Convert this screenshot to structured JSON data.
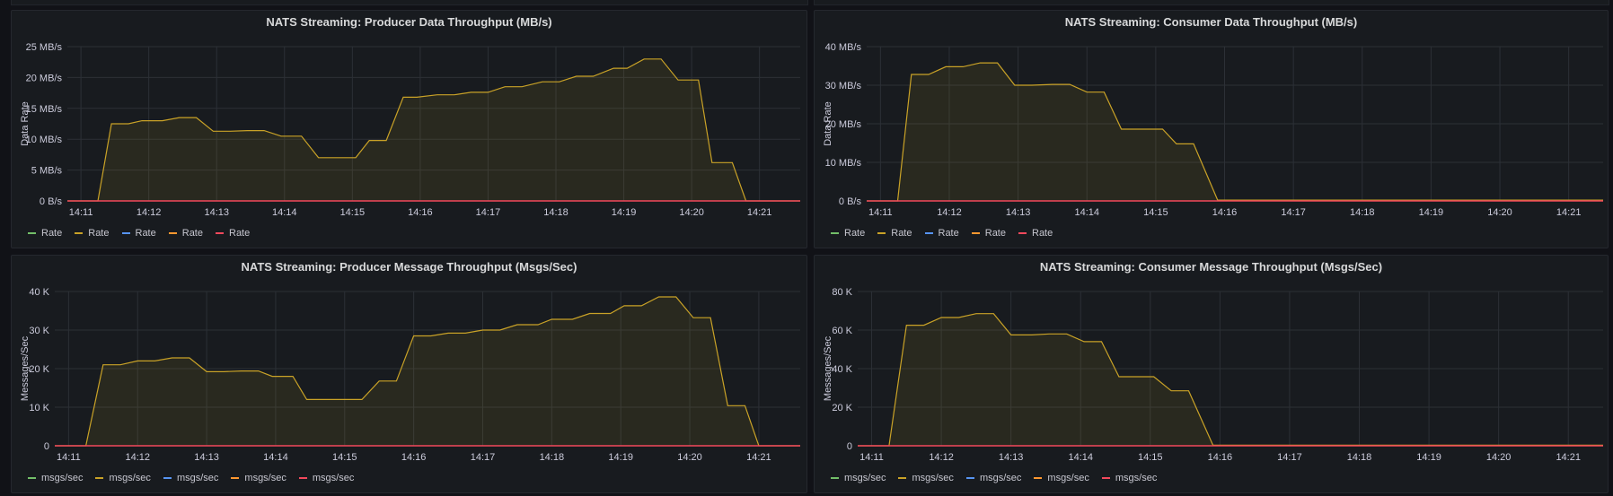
{
  "colors": {
    "background": "#111217",
    "panel": "#181b1f",
    "grid": "#2c3036",
    "text": "#ccccdc",
    "series_green": "#73bf69",
    "series_yellow": "#c9a227",
    "series_blue": "#5794f2",
    "series_orange": "#ff9830",
    "series_red": "#f2495c"
  },
  "panels": [
    {
      "id": "producer-data",
      "title": "NATS Streaming: Producer Data Throughput (MB/s)",
      "legend": [
        "Rate",
        "Rate",
        "Rate",
        "Rate",
        "Rate"
      ]
    },
    {
      "id": "consumer-data",
      "title": "NATS Streaming: Consumer Data Throughput (MB/s)",
      "legend": [
        "Rate",
        "Rate",
        "Rate",
        "Rate",
        "Rate"
      ]
    },
    {
      "id": "producer-msg",
      "title": "NATS Streaming: Producer Message Throughput (Msgs/Sec)",
      "legend": [
        "msgs/sec",
        "msgs/sec",
        "msgs/sec",
        "msgs/sec",
        "msgs/sec"
      ]
    },
    {
      "id": "consumer-msg",
      "title": "NATS Streaming: Consumer Message Throughput (Msgs/Sec)",
      "legend": [
        "msgs/sec",
        "msgs/sec",
        "msgs/sec",
        "msgs/sec",
        "msgs/sec"
      ]
    }
  ],
  "chart_data": [
    {
      "type": "area",
      "title": "NATS Streaming: Producer Data Throughput (MB/s)",
      "ylabel": "Data Rate",
      "yticks": [
        "0 B/s",
        "5 MB/s",
        "10 MB/s",
        "15 MB/s",
        "20 MB/s",
        "25 MB/s"
      ],
      "ylim": [
        0,
        25
      ],
      "xticks": [
        "14:11",
        "14:12",
        "14:13",
        "14:14",
        "14:15",
        "14:16",
        "14:17",
        "14:18",
        "14:19",
        "14:20",
        "14:21"
      ],
      "xlim": [
        10.8,
        21.6
      ],
      "x": [
        10.8,
        11.25,
        11.45,
        11.7,
        11.9,
        12.2,
        12.45,
        12.7,
        12.95,
        13.2,
        13.45,
        13.7,
        13.95,
        14.25,
        14.5,
        14.8,
        15.05,
        15.25,
        15.5,
        15.75,
        15.95,
        16.25,
        16.5,
        16.75,
        17.0,
        17.25,
        17.5,
        17.8,
        18.05,
        18.3,
        18.55,
        18.85,
        19.05,
        19.3,
        19.55,
        19.8,
        20.1,
        20.3,
        20.6,
        20.8,
        21.0,
        21.6
      ],
      "series": [
        {
          "values": [
            0,
            0,
            12.5,
            12.5,
            13.0,
            13.0,
            13.5,
            13.5,
            11.3,
            11.3,
            11.4,
            11.4,
            10.5,
            10.5,
            7.0,
            7.0,
            7.0,
            9.8,
            9.8,
            16.8,
            16.8,
            17.2,
            17.2,
            17.6,
            17.6,
            18.5,
            18.5,
            19.3,
            19.3,
            20.2,
            20.2,
            21.5,
            21.5,
            23.0,
            23.0,
            19.6,
            19.6,
            6.2,
            6.2,
            0,
            0,
            0
          ]
        },
        {
          "values": [
            0,
            0,
            0,
            0,
            0,
            0,
            0,
            0,
            0,
            0,
            0,
            0,
            0,
            0,
            0,
            0,
            0,
            0,
            0,
            0,
            0,
            0,
            0,
            0,
            0,
            0,
            0,
            0,
            0,
            0,
            0,
            0,
            0,
            0,
            0,
            0,
            0,
            0,
            0,
            0,
            0,
            0
          ]
        }
      ]
    },
    {
      "type": "area",
      "title": "NATS Streaming: Consumer Data Throughput (MB/s)",
      "ylabel": "Data Rate",
      "yticks": [
        "0 B/s",
        "10 MB/s",
        "20 MB/s",
        "30 MB/s",
        "40 MB/s"
      ],
      "ylim": [
        0,
        40
      ],
      "xticks": [
        "14:11",
        "14:12",
        "14:13",
        "14:14",
        "14:15",
        "14:16",
        "14:17",
        "14:18",
        "14:19",
        "14:20",
        "14:21"
      ],
      "xlim": [
        10.8,
        21.5
      ],
      "x": [
        10.8,
        11.25,
        11.45,
        11.7,
        11.95,
        12.2,
        12.45,
        12.7,
        12.95,
        13.2,
        13.5,
        13.75,
        14.0,
        14.25,
        14.5,
        14.8,
        15.1,
        15.3,
        15.55,
        15.9,
        21.5
      ],
      "series": [
        {
          "values": [
            0,
            0,
            32.8,
            32.8,
            34.8,
            34.8,
            35.8,
            35.8,
            30.0,
            30.0,
            30.2,
            30.2,
            28.2,
            28.2,
            18.6,
            18.6,
            18.6,
            14.8,
            14.8,
            0.2,
            0.2
          ]
        },
        {
          "values": [
            0,
            0,
            0,
            0,
            0,
            0,
            0,
            0,
            0,
            0,
            0,
            0,
            0,
            0,
            0,
            0,
            0,
            0,
            0,
            0,
            0
          ]
        }
      ]
    },
    {
      "type": "area",
      "title": "NATS Streaming: Producer Message Throughput (Msgs/Sec)",
      "ylabel": "Messages/Sec",
      "yticks": [
        "0",
        "10 K",
        "20 K",
        "30 K",
        "40 K"
      ],
      "ylim": [
        0,
        40
      ],
      "xticks": [
        "14:11",
        "14:12",
        "14:13",
        "14:14",
        "14:15",
        "14:16",
        "14:17",
        "14:18",
        "14:19",
        "14:20",
        "14:21"
      ],
      "xlim": [
        10.8,
        21.6
      ],
      "x": [
        10.8,
        11.25,
        11.5,
        11.75,
        12.0,
        12.25,
        12.5,
        12.75,
        13.0,
        13.25,
        13.5,
        13.75,
        13.95,
        14.25,
        14.45,
        14.75,
        14.95,
        15.25,
        15.5,
        15.75,
        16.0,
        16.25,
        16.5,
        16.75,
        17.0,
        17.25,
        17.5,
        17.8,
        18.0,
        18.3,
        18.55,
        18.85,
        19.05,
        19.3,
        19.55,
        19.8,
        20.05,
        20.3,
        20.55,
        20.8,
        21.0,
        21.6
      ],
      "series": [
        {
          "values": [
            0,
            0,
            21.0,
            21.0,
            22.0,
            22.0,
            22.8,
            22.8,
            19.2,
            19.2,
            19.4,
            19.4,
            18.0,
            18.0,
            12.0,
            12.0,
            12.0,
            12.0,
            16.8,
            16.8,
            28.5,
            28.5,
            29.2,
            29.2,
            30.0,
            30.0,
            31.4,
            31.4,
            32.8,
            32.8,
            34.3,
            34.3,
            36.3,
            36.3,
            38.6,
            38.6,
            33.2,
            33.2,
            10.4,
            10.4,
            0,
            0
          ]
        },
        {
          "values": [
            0,
            0,
            0,
            0,
            0,
            0,
            0,
            0,
            0,
            0,
            0,
            0,
            0,
            0,
            0,
            0,
            0,
            0,
            0,
            0,
            0,
            0,
            0,
            0,
            0,
            0,
            0,
            0,
            0,
            0,
            0,
            0,
            0,
            0,
            0,
            0,
            0,
            0,
            0,
            0,
            0,
            0
          ]
        }
      ]
    },
    {
      "type": "area",
      "title": "NATS Streaming: Consumer Message Throughput (Msgs/Sec)",
      "ylabel": "Messages/Sec",
      "yticks": [
        "0",
        "20 K",
        "40 K",
        "60 K",
        "80 K"
      ],
      "ylim": [
        0,
        80
      ],
      "xticks": [
        "14:11",
        "14:12",
        "14:13",
        "14:14",
        "14:15",
        "14:16",
        "14:17",
        "14:18",
        "14:19",
        "14:20",
        "14:21"
      ],
      "xlim": [
        10.8,
        21.5
      ],
      "x": [
        10.8,
        11.25,
        11.5,
        11.75,
        12.0,
        12.25,
        12.5,
        12.75,
        13.0,
        13.3,
        13.55,
        13.8,
        14.05,
        14.3,
        14.55,
        14.8,
        15.05,
        15.3,
        15.55,
        15.9,
        21.5
      ],
      "series": [
        {
          "values": [
            0,
            0,
            62.5,
            62.5,
            66.5,
            66.5,
            68.5,
            68.5,
            57.5,
            57.5,
            58.0,
            58.0,
            54.0,
            54.0,
            35.8,
            35.8,
            35.8,
            28.5,
            28.5,
            0.3,
            0.3
          ]
        },
        {
          "values": [
            0,
            0,
            0,
            0,
            0,
            0,
            0,
            0,
            0,
            0,
            0,
            0,
            0,
            0,
            0,
            0,
            0,
            0,
            0,
            0,
            0
          ]
        }
      ]
    }
  ]
}
